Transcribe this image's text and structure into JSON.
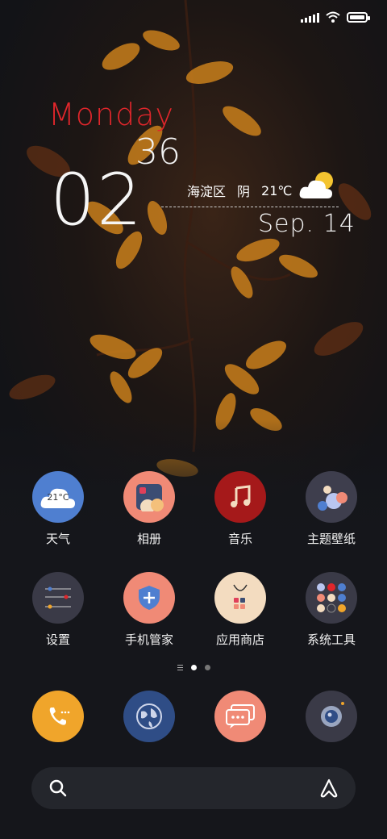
{
  "status_bar": {
    "signal_icon": "signal-bars-icon",
    "wifi_icon": "wifi-icon",
    "battery_icon": "battery-icon",
    "battery_level": 0.9
  },
  "clock_widget": {
    "day": "Monday",
    "minute": "36",
    "hour": "02",
    "location": "海淀区",
    "condition": "阴",
    "temperature": "21℃",
    "date": "Sep. 14",
    "weather_icon": "cloudy-sun-icon"
  },
  "apps_row1": [
    {
      "label": "天气",
      "icon": "weather-cloud-icon",
      "badge": "21°C",
      "color": "#4f7fd0"
    },
    {
      "label": "相册",
      "icon": "gallery-icon",
      "color": "#f08a76"
    },
    {
      "label": "音乐",
      "icon": "music-note-icon",
      "color": "#a5191a"
    },
    {
      "label": "主题壁纸",
      "icon": "themes-icon",
      "color": "#3e3e4d"
    }
  ],
  "apps_row2": [
    {
      "label": "设置",
      "icon": "settings-sliders-icon",
      "color": "#3a3a47"
    },
    {
      "label": "手机管家",
      "icon": "security-shield-icon",
      "color": "#f08a76"
    },
    {
      "label": "应用商店",
      "icon": "shopping-bag-icon",
      "color": "#f3dcc0"
    },
    {
      "label": "系统工具",
      "icon": "folder-icon",
      "color": "#3a3a47"
    }
  ],
  "dock": [
    {
      "icon": "phone-icon",
      "color": "#f0a52b"
    },
    {
      "icon": "browser-globe-icon",
      "color": "#2f4d86"
    },
    {
      "icon": "messages-icon",
      "color": "#f08a76"
    },
    {
      "icon": "camera-icon",
      "color": "#3a3a47"
    }
  ],
  "page_indicator": {
    "pages": 2,
    "active": 0
  },
  "search": {
    "search_icon": "search-icon",
    "assistant_icon": "assistant-a-icon"
  }
}
